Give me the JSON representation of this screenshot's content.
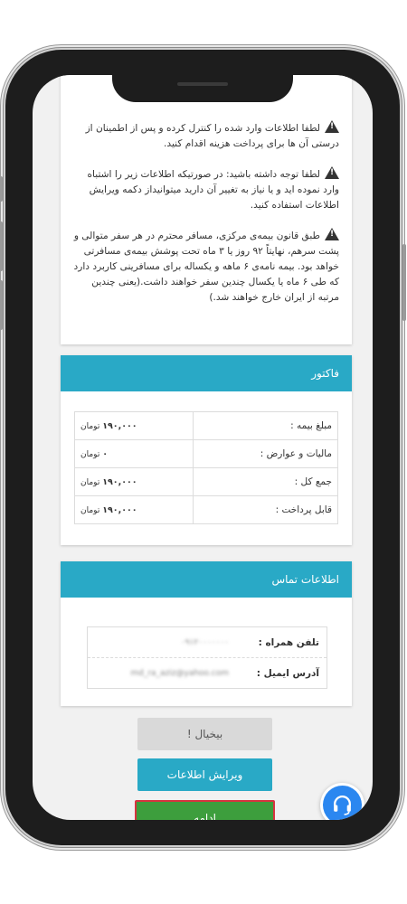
{
  "warnings": [
    "لطفا اطلاعات وارد شده را کنترل کرده و پس از اطمینان از درستی آن ها برای پرداخت هزینه اقدام کنید.",
    "لطفا توجه داشته باشید: در صورتیکه اطلاعات زیر را اشتباه وارد نموده اید و یا نیاز به تغییر آن دارید میتوانیداز دکمه ویرایش اطلاعات استفاده کنید.",
    "طبق قانون بیمه‌ی مرکزی، مسافر محترم در هر سفر متوالی و پشت سرهم، نهایتاً ۹۲ روز یا ۳ ماه تحت پوشش بیمه‌ی مسافرتی خواهد بود. بیمه نامه‌ی ۶ ماهه و یکساله برای مسافرینی کاربرد دارد که طی ۶ ماه یا یکسال چندین سفر خواهند داشت.(یعنی چندین مرتبه از ایران خارج خواهند شد.)"
  ],
  "invoice": {
    "title": "فاکتور",
    "rows": [
      {
        "label": "مبلغ بیمه :",
        "amount": "۱۹۰,۰۰۰",
        "unit": "تومان"
      },
      {
        "label": "مالیات و عوارض :",
        "amount": "۰",
        "unit": "تومان"
      },
      {
        "label": "جمع کل :",
        "amount": "۱۹۰,۰۰۰",
        "unit": "تومان"
      },
      {
        "label": "قابل پرداخت :",
        "amount": "۱۹۰,۰۰۰",
        "unit": "تومان"
      }
    ]
  },
  "contact": {
    "title": "اطلاعات تماس",
    "phone_label": "تلفن همراه :",
    "phone_value": "۰۹۱۲۰۰۰۰۰۰۰",
    "email_label": "آدرس ایمیل :",
    "email_value": "md_ra_aziz@yahoo.com"
  },
  "buttons": {
    "back": "بیخیال !",
    "edit": "ویرایش اطلاعات",
    "next": "ادامه"
  },
  "colors": {
    "accent": "#29a9c6",
    "primary": "#3d9e3d",
    "help": "#2b87f0"
  }
}
